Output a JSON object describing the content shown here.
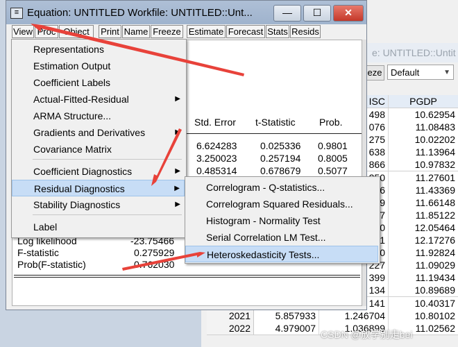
{
  "bg_window": {
    "title": "e: UNTITLED::Untit",
    "toolbar_button": "eze",
    "sample_select": "Default",
    "grid": {
      "col_left_header": "ISC",
      "col_right_header": "PGDP",
      "rows": [
        {
          "year": "",
          "a": "",
          "b": "498",
          "c": "10.62954"
        },
        {
          "year": "",
          "a": "",
          "b": "076",
          "c": "11.08483"
        },
        {
          "year": "",
          "a": "",
          "b": "275",
          "c": "10.02202"
        },
        {
          "year": "",
          "a": "",
          "b": "638",
          "c": "11.13964"
        },
        {
          "year": "",
          "a": "",
          "b": "866",
          "c": "10.97832"
        },
        {
          "year": "",
          "a": "",
          "b": "250",
          "c": "11.27601"
        },
        {
          "year": "",
          "a": "",
          "b": "6",
          "c": "11.43369"
        },
        {
          "year": "",
          "a": "",
          "b": "9",
          "c": "11.66148"
        },
        {
          "year": "",
          "a": "",
          "b": "7",
          "c": "11.85122"
        },
        {
          "year": "",
          "a": "",
          "b": "0",
          "c": "12.05464"
        },
        {
          "year": "",
          "a": "",
          "b": "1",
          "c": "12.17276"
        },
        {
          "year": "",
          "a": "",
          "b": "0",
          "c": "11.92824"
        },
        {
          "year": "",
          "a": "",
          "b": "227",
          "c": "11.09029"
        },
        {
          "year": "",
          "a": "",
          "b": "399",
          "c": "11.19434"
        },
        {
          "year": "",
          "a": "",
          "b": "134",
          "c": "10.89689"
        },
        {
          "year": "",
          "a": "",
          "b": "141",
          "c": "10.40317"
        },
        {
          "year": "2021",
          "a": "5.857933",
          "b": "1.246704",
          "c": "10.80102"
        },
        {
          "year": "2022",
          "a": "4.979007",
          "b": "1.036899",
          "c": "11.02562"
        }
      ]
    }
  },
  "eq_window": {
    "title": "Equation: UNTITLED   Workfile: UNTITLED::Unt...",
    "sys_icon": "≡",
    "min_label": "—",
    "max_label": "☐",
    "close_label": "✕",
    "toolbar": [
      "View",
      "Proc",
      "Object",
      "Print",
      "Name",
      "Freeze",
      "Estimate",
      "Forecast",
      "Stats",
      "Resids"
    ],
    "table": {
      "headers": {
        "std_error": "Std. Error",
        "t_stat": "t-Statistic",
        "prob": "Prob."
      },
      "rows": [
        {
          "se": "6.624283",
          "t": "0.025336",
          "p": "0.9801"
        },
        {
          "se": "3.250023",
          "t": "0.257194",
          "p": "0.8005"
        },
        {
          "se": "0.485314",
          "t": "0.678679",
          "p": "0.5077"
        }
      ],
      "stats": [
        {
          "label": "Log likelihood",
          "value": "-23.75466"
        },
        {
          "label": "F-statistic",
          "value": "0.275929"
        },
        {
          "label": "Prob(F-statistic)",
          "value": "0.762030"
        }
      ]
    }
  },
  "view_menu": {
    "items": [
      "Representations",
      "Estimation Output",
      "Coefficient Labels",
      "Actual-Fitted-Residual",
      "ARMA Structure...",
      "Gradients and Derivatives",
      "Covariance Matrix",
      "Coefficient Diagnostics",
      "Residual Diagnostics",
      "Stability Diagnostics",
      "Label"
    ],
    "submenu_arrow": "▶"
  },
  "residual_submenu": {
    "items": [
      "Correlogram - Q-statistics...",
      "Correlogram Squared Residuals...",
      "Histogram - Normality Test",
      "Serial Correlation LM Test...",
      "Heteroskedasticity Tests..."
    ]
  },
  "watermark": "CSDN @放学别走bei",
  "colors": {
    "arrow": "#e8423a",
    "highlight": "#c7ddf6",
    "titlebar": "#9fb3cd"
  }
}
